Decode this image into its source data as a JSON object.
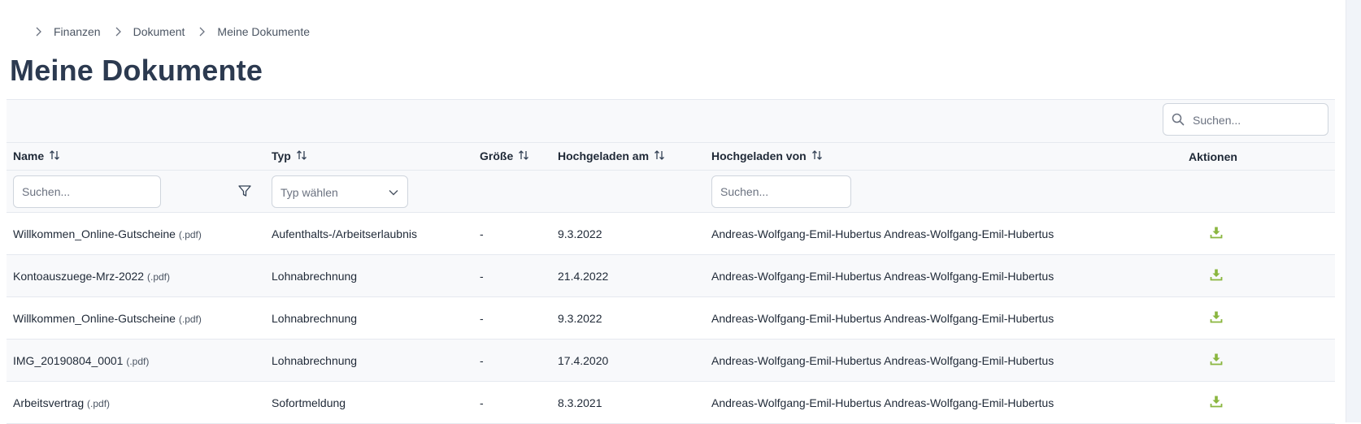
{
  "breadcrumb": {
    "items": [
      "Finanzen",
      "Dokument",
      "Meine Dokumente"
    ]
  },
  "page": {
    "title": "Meine Dokumente"
  },
  "toolbar": {
    "search_placeholder": "Suchen..."
  },
  "table": {
    "columns": {
      "name": "Name",
      "type": "Typ",
      "size": "Größe",
      "uploaded_at": "Hochgeladen am",
      "uploaded_by": "Hochgeladen von",
      "actions": "Aktionen"
    },
    "filters": {
      "name_placeholder": "Suchen...",
      "type_placeholder": "Typ wählen",
      "uploaded_by_placeholder": "Suchen..."
    },
    "rows": [
      {
        "name": "Willkommen_Online-Gutscheine",
        "ext": "(.pdf)",
        "type": "Aufenthalts-/Arbeitserlaubnis",
        "size": "-",
        "date": "9.3.2022",
        "by": "Andreas-Wolfgang-Emil-Hubertus Andreas-Wolfgang-Emil-Hubertus"
      },
      {
        "name": "Kontoauszuege-Mrz-2022",
        "ext": "(.pdf)",
        "type": "Lohnabrechnung",
        "size": "-",
        "date": "21.4.2022",
        "by": "Andreas-Wolfgang-Emil-Hubertus Andreas-Wolfgang-Emil-Hubertus"
      },
      {
        "name": "Willkommen_Online-Gutscheine",
        "ext": "(.pdf)",
        "type": "Lohnabrechnung",
        "size": "-",
        "date": "9.3.2022",
        "by": "Andreas-Wolfgang-Emil-Hubertus Andreas-Wolfgang-Emil-Hubertus"
      },
      {
        "name": "IMG_20190804_0001",
        "ext": "(.pdf)",
        "type": "Lohnabrechnung",
        "size": "-",
        "date": "17.4.2020",
        "by": "Andreas-Wolfgang-Emil-Hubertus Andreas-Wolfgang-Emil-Hubertus"
      },
      {
        "name": "Arbeitsvertrag",
        "ext": "(.pdf)",
        "type": "Sofortmeldung",
        "size": "-",
        "date": "8.3.2021",
        "by": "Andreas-Wolfgang-Emil-Hubertus Andreas-Wolfgang-Emil-Hubertus"
      }
    ]
  },
  "icons": {
    "breadcrumb_separator": "chevron-right-icon",
    "sort": "sort-icon",
    "search": "search-icon",
    "filter": "filter-icon",
    "dropdown": "chevron-down-icon",
    "download": "download-icon"
  },
  "colors": {
    "title": "#2c3a50",
    "download": "#8ab63f",
    "header_bg": "#f8f9fb",
    "border": "#e5e9ef"
  }
}
